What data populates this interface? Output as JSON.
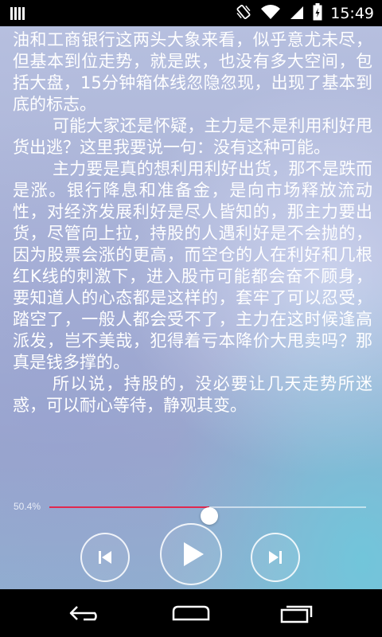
{
  "status_bar": {
    "time": "15:49",
    "icons": [
      "signal-bars-icon",
      "vibrate-icon",
      "wifi-icon",
      "cell-signal-icon",
      "battery-icon"
    ]
  },
  "article": {
    "paragraphs": [
      "油和工商银行这两头大象来看，似乎意尤未尽，但基本到位走势，就是跌，也没有多大空间，包括大盘，15分钟箱体线忽隐忽现，出现了基本到底的标志。",
      "可能大家还是怀疑，主力是不是利用利好甩货出逃？这里我要说一句：没有这种可能。",
      "主力要是真的想利用利好出货，那不是跌而是涨。银行降息和准备金，是向市场释放流动性，对经济发展利好是尽人皆知的，那主力要出货，尽管向上拉，持股的人遇利好是不会抛的，因为股票会涨的更高，而空仓的人在利好和几根红K线的刺激下，进入股市可能都会奋不顾身，要知道人的心态都是这样的，套牢了可以忍受，踏空了，一般人都会受不了，主力在这时候逢高派发，岂不美哉，犯得着亏本降价大甩卖吗？那真是钱多撑的。",
      "所以说，持股的，没必要让几天走势所迷惑，可以耐心等待，静观其变。"
    ]
  },
  "player": {
    "progress_label": "50.4%",
    "progress_fraction": 0.504,
    "accent_color": "#e0284f",
    "prev_icon": "skip-previous-icon",
    "play_icon": "play-icon",
    "next_icon": "skip-next-icon"
  },
  "nav_bar": {
    "back_icon": "back-icon",
    "home_icon": "home-icon",
    "recents_icon": "recent-apps-icon"
  }
}
